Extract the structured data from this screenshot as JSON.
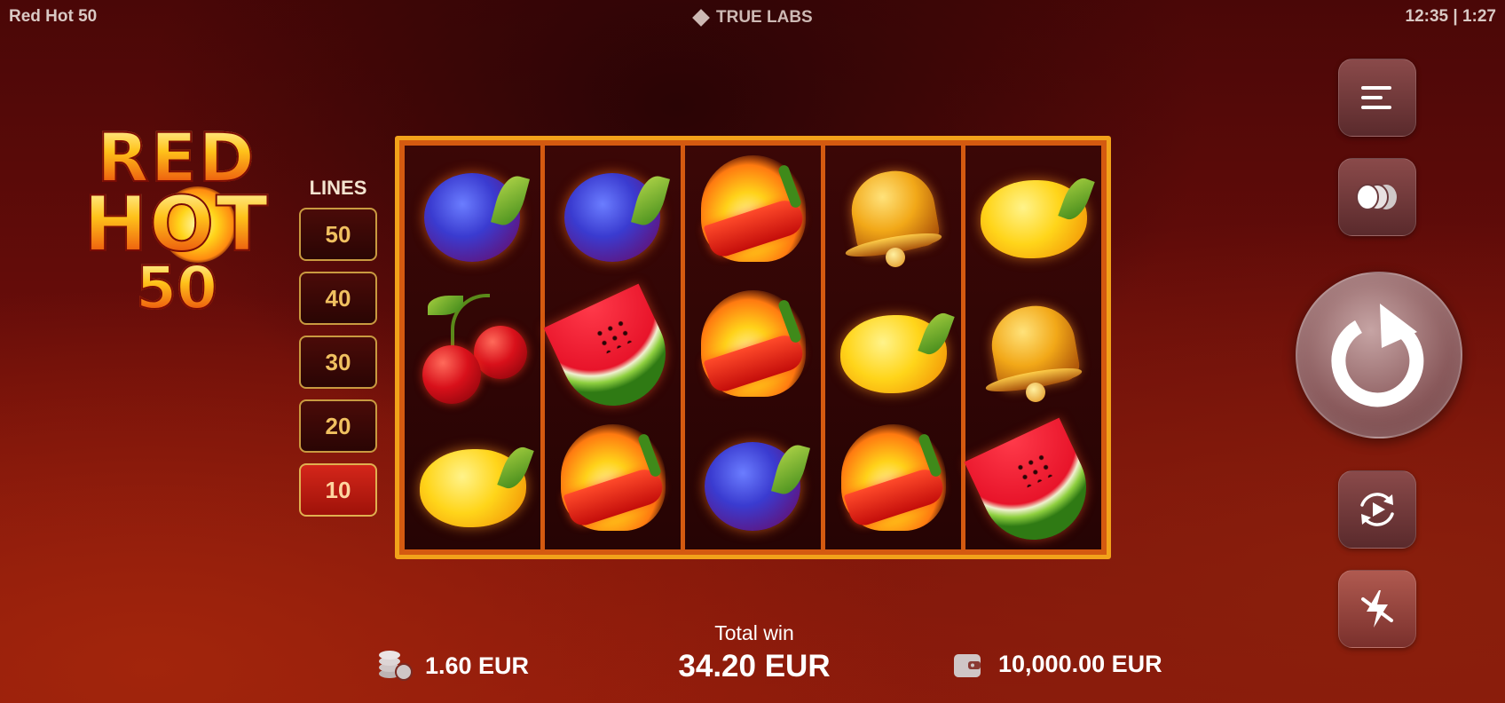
{
  "topbar": {
    "title": "Red Hot 50",
    "brand": "TRUE LABS",
    "clock": "12:35 | 1:27"
  },
  "logo": {
    "line1": "RED",
    "line2": "HOT",
    "line3": "50"
  },
  "lines": {
    "label": "LINES",
    "options": [
      "50",
      "40",
      "30",
      "20",
      "10"
    ],
    "selected": "10"
  },
  "reels": [
    [
      "plum",
      "cherry",
      "lemon"
    ],
    [
      "plum",
      "watermelon",
      "chili"
    ],
    [
      "chili",
      "chili",
      "plum"
    ],
    [
      "bell",
      "lemon",
      "chili"
    ],
    [
      "lemon",
      "bell",
      "watermelon"
    ]
  ],
  "controls": {
    "menu_icon": "menu-icon",
    "bet_icon": "coins-icon",
    "spin_icon": "spin-icon",
    "autoplay_icon": "autoplay-icon",
    "turbo_icon": "turbo-icon"
  },
  "bottom": {
    "bet_value": "1.60 EUR",
    "total_win_label": "Total win",
    "total_win_value": "34.20 EUR",
    "balance_value": "10,000.00 EUR"
  },
  "colors": {
    "frame": "#f2a21a",
    "line_active": "#d4261a",
    "line_text": "#f0c060"
  }
}
